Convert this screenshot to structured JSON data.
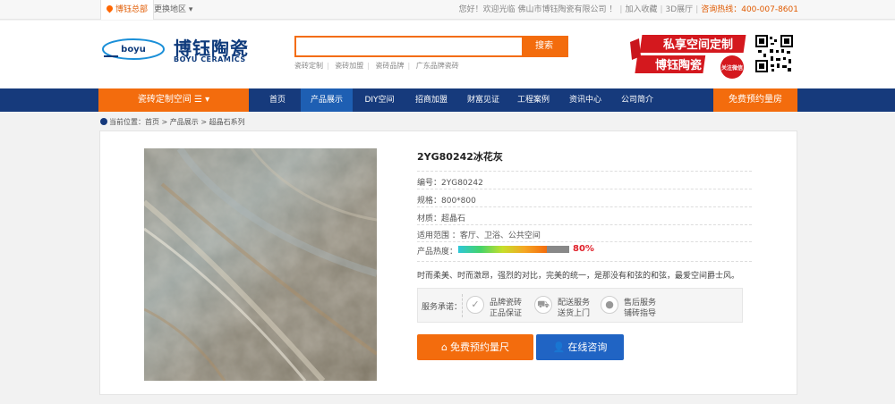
{
  "topbar": {
    "location": "博钰总部",
    "switch_region": "更换地区 ▾",
    "welcome": "您好！欢迎光临 佛山市博钰陶瓷有限公司 ！",
    "join": "加入收藏",
    "showroom": "3D展厅",
    "hotline": "咨询热线：400-007-8601"
  },
  "brand": {
    "logo_mark": "boyu",
    "name_cn": "博钰陶瓷",
    "name_en": "BOYU CERAMICS"
  },
  "search": {
    "placeholder": "",
    "button": "搜索",
    "hot_words": [
      "瓷砖定制",
      "瓷砖加盟",
      "瓷砖品牌",
      "广东品牌瓷砖"
    ]
  },
  "promo": {
    "line1": "私享空间定制",
    "line2": "博钰陶瓷",
    "badge": "关注微信"
  },
  "nav": {
    "category": "瓷砖定制空间 ☰ ▾",
    "items": [
      "首页",
      "产品展示",
      "DIY空间",
      "招商加盟",
      "财富见证",
      "工程案例",
      "资讯中心",
      "公司简介"
    ],
    "active": "产品展示",
    "book": "免费预约量房"
  },
  "breadcrumb": {
    "label": "当前位置：",
    "path": "首页 > 产品展示 > 超晶石系列"
  },
  "product": {
    "title": "2YG80242冰花灰",
    "code": "编号：2YG80242",
    "size": "规格：800*800",
    "material": "材质：超晶石",
    "usage": "适用范围 ：客厅、卫浴、公共空间",
    "heat_label": "产品热度：",
    "heat_value": "80%",
    "heat_fraction": 0.8,
    "description": "时而柔美、时而激昂，强烈的对比，完美的统一，是那没有和弦的和弦，最爱空间爵士风。",
    "service_label": "服务承诺：",
    "services": [
      {
        "icon": "check-icon",
        "line1": "品牌瓷砖",
        "line2": "正品保证"
      },
      {
        "icon": "truck-icon",
        "line1": "配送服务",
        "line2": "送货上门"
      },
      {
        "icon": "chat-icon",
        "line1": "售后服务",
        "line2": "铺砖指导"
      }
    ],
    "book_button": "免费预约量尺",
    "consult_button": "在线咨询"
  },
  "colors": {
    "brand_blue": "#163a7c",
    "accent_orange": "#f36c0d",
    "consult_blue": "#2064c4",
    "heat_red": "#e0202a"
  }
}
